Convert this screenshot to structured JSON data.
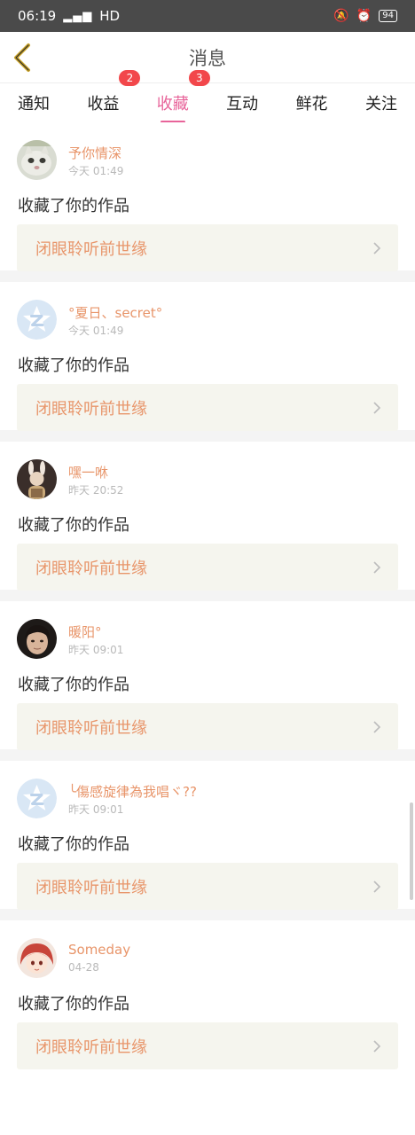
{
  "status": {
    "time": "06:19",
    "network": "4G",
    "hd": "HD",
    "battery": "94"
  },
  "header": {
    "title": "消息"
  },
  "tabs": [
    {
      "label": "通知",
      "badge": ""
    },
    {
      "label": "收益",
      "badge": "2"
    },
    {
      "label": "收藏",
      "badge": "3",
      "active": true
    },
    {
      "label": "互动",
      "badge": ""
    },
    {
      "label": "鲜花",
      "badge": ""
    },
    {
      "label": "关注",
      "badge": ""
    }
  ],
  "feed": [
    {
      "user": "予你情深",
      "time": "今天 01:49",
      "action": "收藏了你的作品",
      "work": "闭眼聆听前世缘"
    },
    {
      "user": "°夏日、secret°",
      "time": "今天 01:49",
      "action": "收藏了你的作品",
      "work": "闭眼聆听前世缘"
    },
    {
      "user": "嘿一咻",
      "time": "昨天 20:52",
      "action": "收藏了你的作品",
      "work": "闭眼聆听前世缘"
    },
    {
      "user": "暖阳°",
      "time": "昨天 09:01",
      "action": "收藏了你的作品",
      "work": "闭眼聆听前世缘"
    },
    {
      "user": "╰傷感旋律為我唱ヾ??",
      "time": "昨天 09:01",
      "action": "收藏了你的作品",
      "work": "闭眼聆听前世缘"
    },
    {
      "user": "Someday",
      "time": "04-28",
      "action": "收藏了你的作品",
      "work": "闭眼聆听前世缘"
    }
  ],
  "colors": {
    "accent": "#e8649a",
    "username": "#e8956a",
    "badge": "#f2474b",
    "work_bg": "#f5f5ee",
    "back_icon": "#c9a227"
  }
}
